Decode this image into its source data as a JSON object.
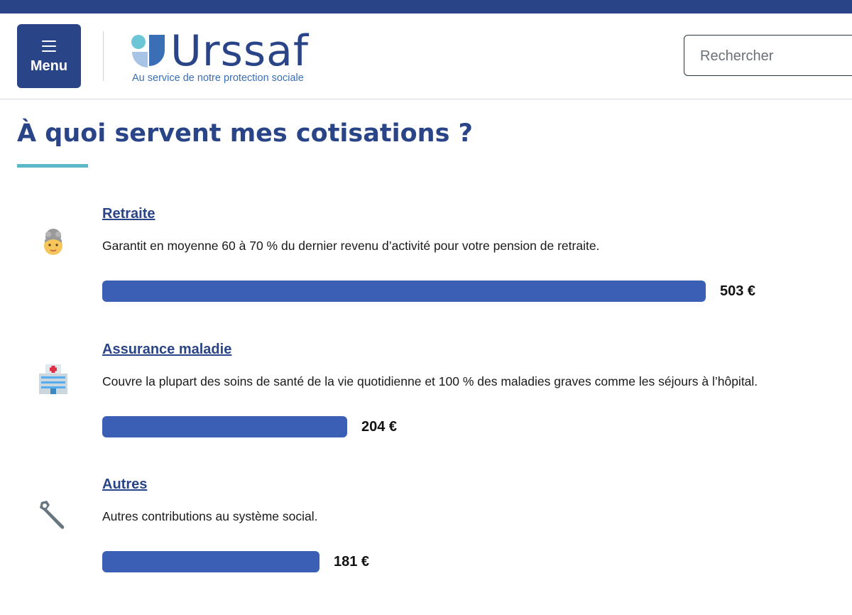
{
  "header": {
    "menu_label": "Menu",
    "logo_name": "Urssaf",
    "logo_tagline": "Au service de notre protection sociale",
    "search_placeholder": "Rechercher"
  },
  "page": {
    "title": "À quoi servent mes cotisations ?"
  },
  "colors": {
    "brand_blue": "#2a4488",
    "bar_blue": "#3a5fb5",
    "accent_teal": "#5bb8c8"
  },
  "items": [
    {
      "title": "Retraite",
      "description": "Garantit en moyenne 60 à 70 % du dernier revenu d’activité pour votre pension de retraite.",
      "amount": "503 €",
      "value": 503,
      "icon": "older-woman-icon"
    },
    {
      "title": "Assurance maladie",
      "description": "Couvre la plupart des soins de santé de la vie quotidienne et 100 % des maladies graves comme les séjours à l’hôpital.",
      "amount": "204 €",
      "value": 204,
      "icon": "hospital-icon"
    },
    {
      "title": "Autres",
      "description": "Autres contributions au système social.",
      "amount": "181 €",
      "value": 181,
      "icon": "wrench-icon"
    }
  ]
}
